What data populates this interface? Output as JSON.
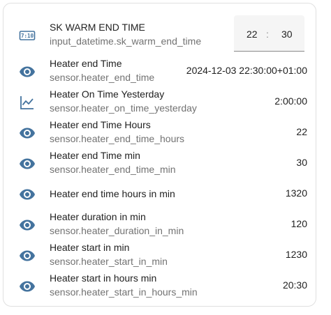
{
  "colors": {
    "icon": "#44739e",
    "primary_text": "#212121",
    "secondary_text": "#727272"
  },
  "datetime_row": {
    "name": "SK WARM END TIME",
    "entity": "input_datetime.sk_warm_end_time",
    "icon": "calendar-clock-icon",
    "hours": "22",
    "separator": ":",
    "minutes": "30"
  },
  "rows": [
    {
      "name": "Heater end Time",
      "entity": "sensor.heater_end_time",
      "value": "2024-12-03 22:30:00+01:00",
      "icon": "eye-icon"
    },
    {
      "name": "Heater On Time Yesterday",
      "entity": "sensor.heater_on_time_yesterday",
      "value": "2:00:00",
      "icon": "chart-line-icon"
    },
    {
      "name": "Heater end Time Hours",
      "entity": "sensor.heater_end_time_hours",
      "value": "22",
      "icon": "eye-icon"
    },
    {
      "name": "Heater end Time min",
      "entity": "sensor.heater_end_time_min",
      "value": "30",
      "icon": "eye-icon"
    },
    {
      "name": "Heater end time hours in min",
      "entity": "",
      "value": "1320",
      "icon": "eye-icon"
    },
    {
      "name": "Heater duration in min",
      "entity": "sensor.heater_duration_in_min",
      "value": "120",
      "icon": "eye-icon"
    },
    {
      "name": "Heater start in min",
      "entity": "sensor.heater_start_in_min",
      "value": "1230",
      "icon": "eye-icon"
    },
    {
      "name": "Heater start in hours min",
      "entity": "sensor.heater_start_in_hours_min",
      "value": "20:30",
      "icon": "eye-icon"
    }
  ]
}
